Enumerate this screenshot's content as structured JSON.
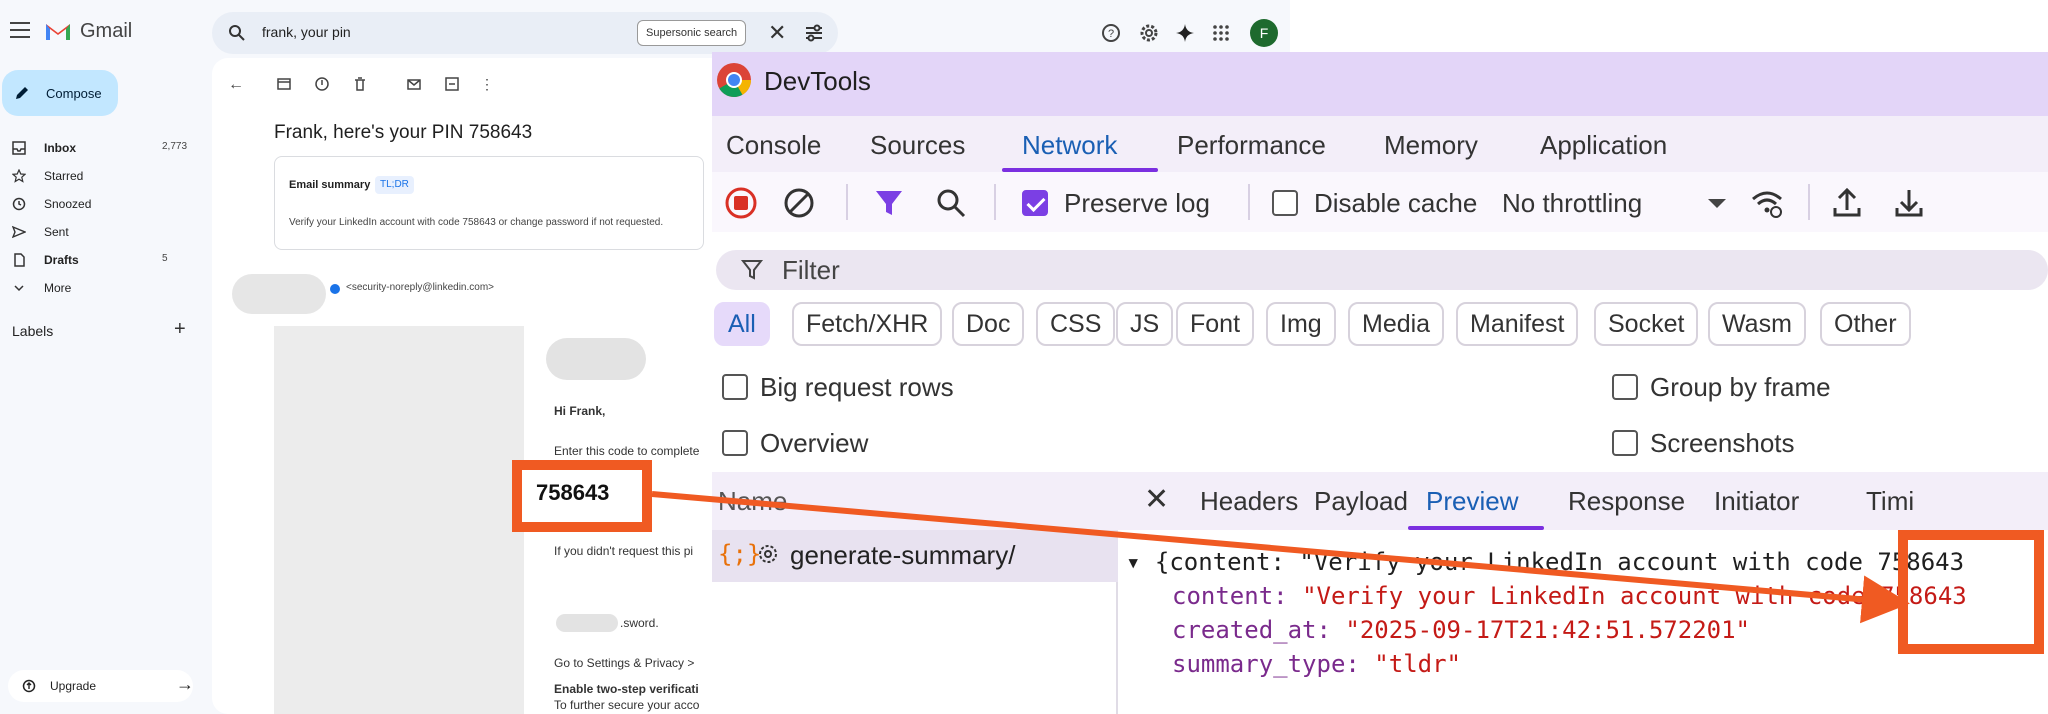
{
  "gmail": {
    "app_name": "Gmail",
    "search": {
      "query": "frank, your pin",
      "supersonic_label": "Supersonic search"
    },
    "avatar_letter": "F",
    "compose_label": "Compose",
    "nav": [
      {
        "label": "Inbox",
        "count": "2,773",
        "icon": "inbox-icon",
        "bold": true
      },
      {
        "label": "Starred",
        "count": "",
        "icon": "star-icon",
        "bold": false
      },
      {
        "label": "Snoozed",
        "count": "",
        "icon": "clock-icon",
        "bold": false
      },
      {
        "label": "Sent",
        "count": "",
        "icon": "send-icon",
        "bold": false
      },
      {
        "label": "Drafts",
        "count": "5",
        "icon": "draft-icon",
        "bold": true
      },
      {
        "label": "More",
        "count": "",
        "icon": "chevron-down-icon",
        "bold": false
      }
    ],
    "labels_heading": "Labels",
    "upgrade_label": "Upgrade",
    "email": {
      "subject": "Frank, here's your PIN 758643",
      "summary_heading": "Email summary",
      "summary_tag": "TL;DR",
      "summary_text": "Verify your LinkedIn account with code 758643 or change password if not requested.",
      "sender": "<security-noreply@linkedin.com>",
      "greeting": "Hi Frank,",
      "line1": "Enter this code to complete",
      "code": "758643",
      "line2": "If you didn't request this pi",
      "line3": ".sword.",
      "line4": "Go to Settings & Privacy >",
      "line5": "To further secure your acco",
      "line6": "Enable two-step verificati"
    }
  },
  "devtools": {
    "title": "DevTools",
    "tabs": [
      "Console",
      "Sources",
      "Network",
      "Performance",
      "Memory",
      "Application"
    ],
    "active_tab": "Network",
    "toolbar": {
      "preserve_log": "Preserve log",
      "disable_cache": "Disable cache",
      "throttling": "No throttling"
    },
    "filter_placeholder": "Filter",
    "type_filters": [
      "All",
      "Fetch/XHR",
      "Doc",
      "CSS",
      "JS",
      "Font",
      "Img",
      "Media",
      "Manifest",
      "Socket",
      "Wasm",
      "Other"
    ],
    "options": {
      "big_request_rows": "Big request rows",
      "group_by_frame": "Group by frame",
      "overview": "Overview",
      "screenshots": "Screenshots"
    },
    "name_header": "Name",
    "request_name": "generate-summary/",
    "detail_tabs": [
      "Headers",
      "Payload",
      "Preview",
      "Response",
      "Initiator",
      "Timi"
    ],
    "active_detail_tab": "Preview",
    "preview": {
      "summary_line": "{content: \"Verify your LinkedIn account with code 758643",
      "content_key": "content",
      "content_value": "\"Verify your LinkedIn account with code 758643",
      "created_key": "created_at",
      "created_value": "\"2025-09-17T21:42:51.572201\"",
      "type_key": "summary_type",
      "type_value": "\"tldr\""
    }
  },
  "colors": {
    "highlight": "#f05a22",
    "devtools_accent": "#7b2fe0",
    "gmail_compose": "#c2e7ff"
  }
}
